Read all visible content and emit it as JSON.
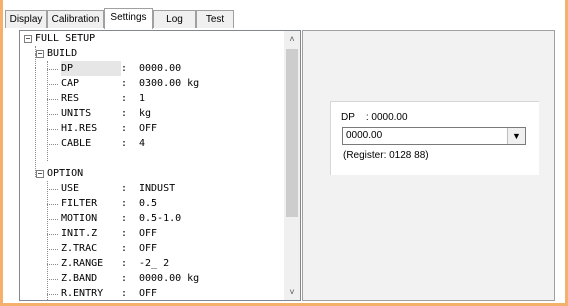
{
  "tabs": [
    "Display",
    "Calibration",
    "Settings",
    "Log",
    "Test"
  ],
  "tree": {
    "root": "FULL SETUP",
    "build": {
      "label": "BUILD",
      "items": [
        {
          "key": "DP",
          "sep": ":",
          "value": "0000.00"
        },
        {
          "key": "CAP",
          "sep": ":",
          "value": "0300.00 kg"
        },
        {
          "key": "RES",
          "sep": ":",
          "value": "1"
        },
        {
          "key": "UNITS",
          "sep": ":",
          "value": "kg"
        },
        {
          "key": "HI.RES",
          "sep": ":",
          "value": "OFF"
        },
        {
          "key": "CABLE",
          "sep": ":",
          "value": "4"
        }
      ]
    },
    "option": {
      "label": "OPTION",
      "items": [
        {
          "key": "USE",
          "sep": ":",
          "value": "INDUST"
        },
        {
          "key": "FILTER",
          "sep": ":",
          "value": "0.5"
        },
        {
          "key": "MOTION",
          "sep": ":",
          "value": "0.5-1.0"
        },
        {
          "key": "INIT.Z",
          "sep": ":",
          "value": "OFF"
        },
        {
          "key": "Z.TRAC",
          "sep": ":",
          "value": "OFF"
        },
        {
          "key": "Z.RANGE",
          "sep": ":",
          "value": "-2_ 2"
        },
        {
          "key": "Z.BAND",
          "sep": ":",
          "value": "0000.00 kg"
        },
        {
          "key": "R.ENTRY",
          "sep": ":",
          "value": "OFF"
        }
      ]
    }
  },
  "detail": {
    "field_label": "DP    : 0000.00",
    "combo_value": "0000.00",
    "register": "(Register: 0128 88)"
  },
  "icons": {
    "collapse": "minus-box-icon",
    "scroll_up": "chevron-up-icon",
    "scroll_down": "chevron-down-icon",
    "combo": "dropdown-arrow-icon"
  }
}
